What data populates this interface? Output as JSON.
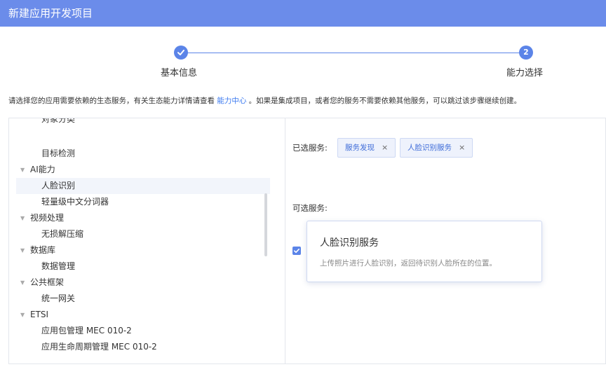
{
  "header": {
    "title": "新建应用开发项目"
  },
  "steps": [
    {
      "label": "基本信息",
      "status": "done"
    },
    {
      "label": "能力选择",
      "number": "2",
      "status": "active"
    }
  ],
  "tip": {
    "before": "请选择您的应用需要依赖的生态服务，有关生态能力详情请查看 ",
    "link": "能力中心",
    "after": " 。如果是集成项目，或者您的服务不需要依赖其他服务，可以跳过该步骤继续创建。"
  },
  "tree": {
    "partial_top": "对象分类",
    "items": [
      {
        "label": "目标检测",
        "level": "child"
      },
      {
        "label": "AI能力",
        "level": "parent"
      },
      {
        "label": "人脸识别",
        "level": "child",
        "selected": true
      },
      {
        "label": "轻量级中文分词器",
        "level": "child"
      },
      {
        "label": "视频处理",
        "level": "parent"
      },
      {
        "label": "无损解压缩",
        "level": "child"
      },
      {
        "label": "数据库",
        "level": "parent"
      },
      {
        "label": "数据管理",
        "level": "child"
      },
      {
        "label": "公共框架",
        "level": "parent"
      },
      {
        "label": "统一网关",
        "level": "child"
      },
      {
        "label": "ETSI",
        "level": "parent"
      },
      {
        "label": "应用包管理 MEC 010-2",
        "level": "child"
      }
    ],
    "partial_bottom": "应用生命周期管理 MEC 010-2"
  },
  "selected_services": {
    "label": "已选服务:",
    "chips": [
      "服务发现",
      "人脸识别服务"
    ],
    "remove_symbol": "×"
  },
  "available_services": {
    "label": "可选服务:",
    "card": {
      "title": "人脸识别服务",
      "description": "上传照片进行人脸识别，返回待识别人脸所在的位置。",
      "checked": true
    }
  },
  "colors": {
    "header_bg": "#6b8cea",
    "accent": "#5b84e8",
    "link": "#3d7bf0"
  }
}
